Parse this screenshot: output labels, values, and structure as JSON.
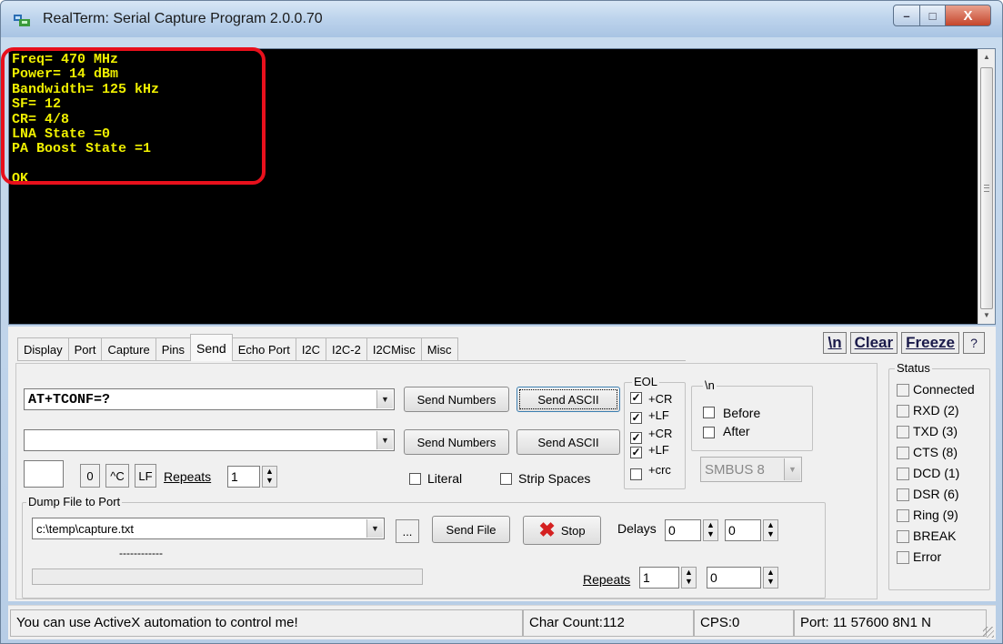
{
  "window": {
    "title": "RealTerm: Serial Capture Program 2.0.0.70",
    "caption_min": "–",
    "caption_max": "□",
    "caption_close": "X"
  },
  "terminal": {
    "lines": [
      "Freq= 470 MHz",
      "Power= 14 dBm",
      "Bandwidth= 125 kHz",
      "SF= 12",
      "CR= 4/8",
      "LNA State =0",
      "PA Boost State =1",
      "",
      "OK"
    ],
    "text_color": "#f0f000",
    "highlight_color": "#e8101c"
  },
  "tabs": [
    {
      "label": "Display",
      "active": false
    },
    {
      "label": "Port",
      "active": false
    },
    {
      "label": "Capture",
      "active": false
    },
    {
      "label": "Pins",
      "active": false
    },
    {
      "label": "Send",
      "active": true
    },
    {
      "label": "Echo Port",
      "active": false
    },
    {
      "label": "I2C",
      "active": false
    },
    {
      "label": "I2C-2",
      "active": false
    },
    {
      "label": "I2CMisc",
      "active": false
    },
    {
      "label": "Misc",
      "active": false
    }
  ],
  "toolbar": {
    "newline_label": "\\n",
    "clear_label": "Clear",
    "freeze_label": "Freeze",
    "help_label": "?"
  },
  "send": {
    "line1_value": "AT+TCONF=?",
    "line2_value": "",
    "send_numbers_1": "Send Numbers",
    "send_ascii_1": "Send ASCII",
    "send_numbers_2": "Send Numbers",
    "send_ascii_2": "Send ASCII",
    "small_input_value": "",
    "btn_0": "0",
    "btn_ctrl_c": "^C",
    "btn_lf": "LF",
    "repeats_label": "Repeats",
    "repeats_value": "1",
    "literal_label": "Literal",
    "strip_spaces_label": "Strip Spaces"
  },
  "eol": {
    "title": "EOL",
    "items": [
      {
        "label": "+CR",
        "checked": true
      },
      {
        "label": "+LF",
        "checked": true
      },
      {
        "label": "+CR",
        "checked": true
      },
      {
        "label": "+LF",
        "checked": true
      },
      {
        "label": "+crc",
        "checked": false
      }
    ]
  },
  "newline_group": {
    "title": "\\n",
    "before_label": "Before",
    "after_label": "After",
    "smbus_value": "SMBUS 8"
  },
  "dump": {
    "title": "Dump File to Port",
    "file_value": "c:\\temp\\capture.txt",
    "browse_label": "...",
    "send_file_label": "Send File",
    "stop_label": "Stop",
    "delays_label": "Delays",
    "delay1_value": "0",
    "delay2_value": "0",
    "dashes": "------------",
    "repeats_label": "Repeats",
    "repeats1_value": "1",
    "repeats2_value": "0",
    "stop_icon_color": "#d42020"
  },
  "status": {
    "title": "Status",
    "items": [
      "Connected",
      "RXD (2)",
      "TXD (3)",
      "CTS (8)",
      "DCD (1)",
      "DSR (6)",
      "Ring (9)",
      "BREAK",
      "Error"
    ]
  },
  "statusbar": {
    "message": "You can use ActiveX automation to control me!",
    "char_count": "Char Count:112",
    "cps": "CPS:0",
    "port": "Port: 11 57600 8N1 N"
  }
}
